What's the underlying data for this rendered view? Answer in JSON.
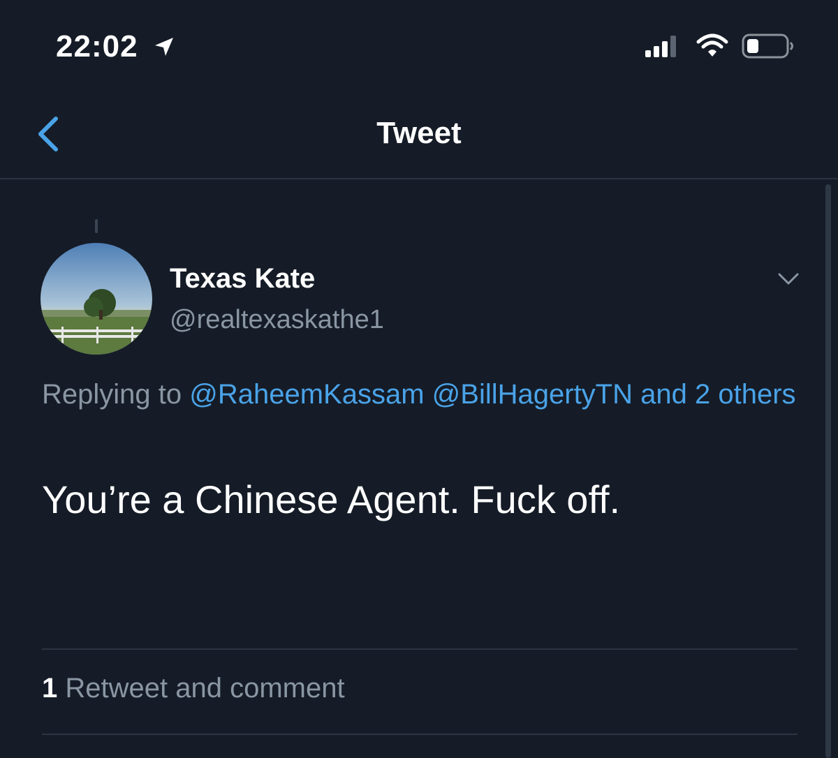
{
  "status_bar": {
    "time": "22:02",
    "icons": [
      "location-arrow-icon",
      "cellular-signal-icon",
      "wifi-icon",
      "battery-icon"
    ]
  },
  "nav": {
    "back_icon": "chevron-left-icon",
    "title": "Tweet"
  },
  "tweet": {
    "author": {
      "display_name": "Texas Kate",
      "handle": "@realtexaskathe1"
    },
    "replying_prefix": "Replying to",
    "mentions": [
      "@RaheemKassam",
      "@BillHagertyTN"
    ],
    "mentions_suffix": "and",
    "others_label": "2 others",
    "text": "You’re a Chinese Agent. Fuck off.",
    "stats": {
      "count": "1",
      "label": "Retweet and comment"
    }
  },
  "colors": {
    "background": "#151c27",
    "accent": "#4aa3e8",
    "secondary_text": "#8a96a3",
    "divider": "#2b3440"
  }
}
